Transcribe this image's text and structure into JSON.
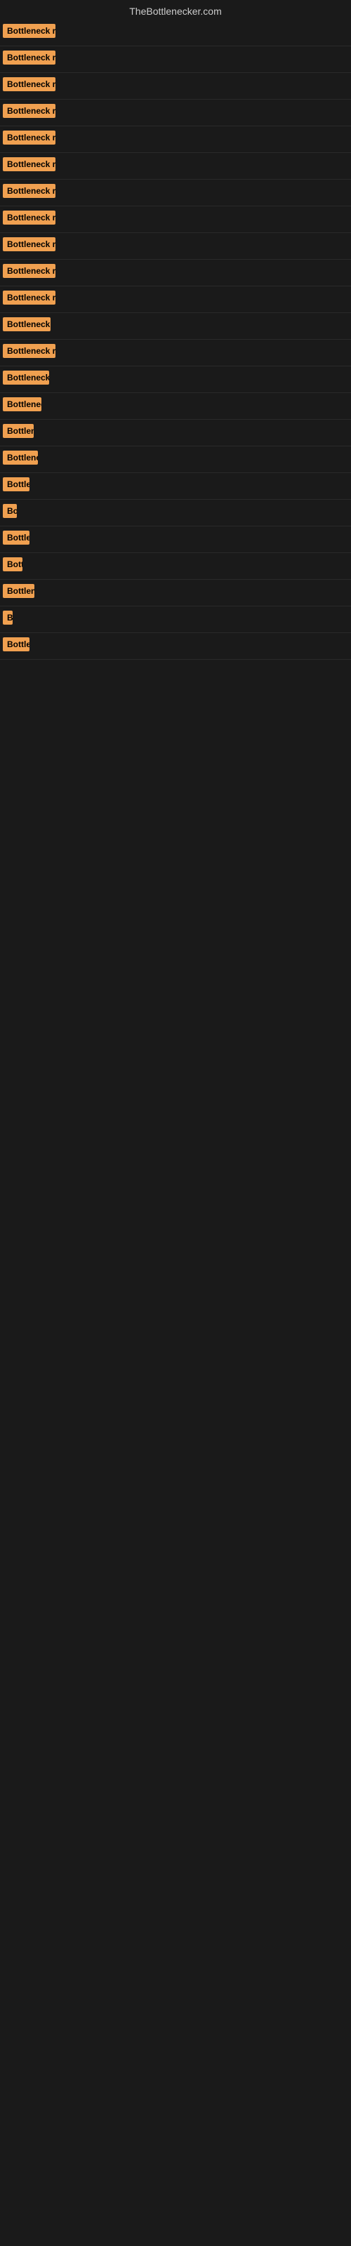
{
  "site": {
    "title": "TheBottlenecker.com"
  },
  "results": [
    {
      "id": 1,
      "label": "Bottleneck result",
      "width": 75
    },
    {
      "id": 2,
      "label": "Bottleneck result",
      "width": 75
    },
    {
      "id": 3,
      "label": "Bottleneck result",
      "width": 75
    },
    {
      "id": 4,
      "label": "Bottleneck result",
      "width": 75
    },
    {
      "id": 5,
      "label": "Bottleneck result",
      "width": 75
    },
    {
      "id": 6,
      "label": "Bottleneck result",
      "width": 75
    },
    {
      "id": 7,
      "label": "Bottleneck result",
      "width": 75
    },
    {
      "id": 8,
      "label": "Bottleneck result",
      "width": 75
    },
    {
      "id": 9,
      "label": "Bottleneck result",
      "width": 75
    },
    {
      "id": 10,
      "label": "Bottleneck result",
      "width": 75
    },
    {
      "id": 11,
      "label": "Bottleneck result",
      "width": 75
    },
    {
      "id": 12,
      "label": "Bottleneck resu",
      "width": 68
    },
    {
      "id": 13,
      "label": "Bottleneck result",
      "width": 75
    },
    {
      "id": 14,
      "label": "Bottleneck resu",
      "width": 66
    },
    {
      "id": 15,
      "label": "Bottleneck r",
      "width": 55
    },
    {
      "id": 16,
      "label": "Bottlen",
      "width": 44
    },
    {
      "id": 17,
      "label": "Bottleneck",
      "width": 50
    },
    {
      "id": 18,
      "label": "Bottle",
      "width": 38
    },
    {
      "id": 19,
      "label": "Bo",
      "width": 20
    },
    {
      "id": 20,
      "label": "Bottle",
      "width": 38
    },
    {
      "id": 21,
      "label": "Bott",
      "width": 28
    },
    {
      "id": 22,
      "label": "Bottlens",
      "width": 45
    },
    {
      "id": 23,
      "label": "B",
      "width": 14
    },
    {
      "id": 24,
      "label": "Bottle",
      "width": 38
    }
  ]
}
